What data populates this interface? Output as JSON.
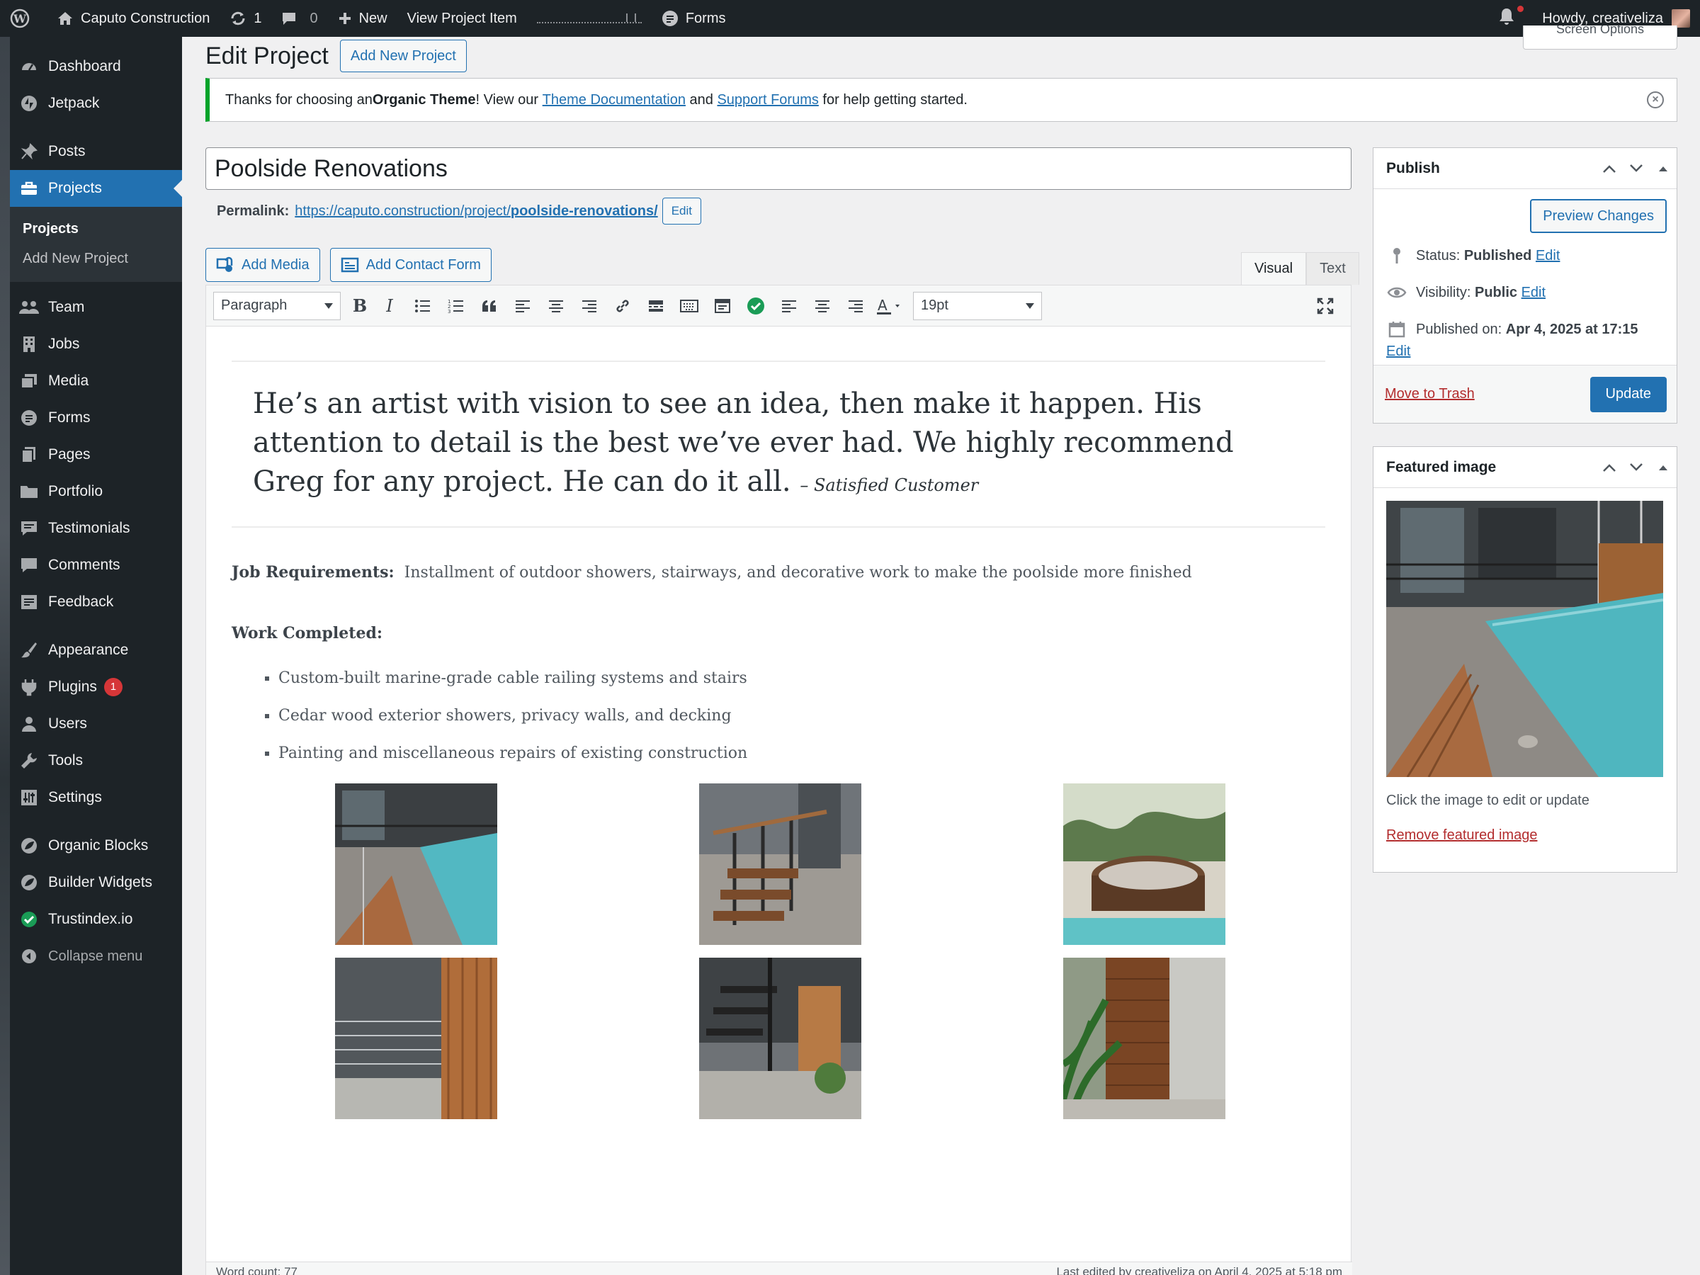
{
  "adminbar": {
    "site_name": "Caputo Construction",
    "updates_count": "1",
    "comments_count": "0",
    "new_label": "New",
    "view_item": "View Project Item",
    "forms_label": "Forms",
    "howdy": "Howdy, creativeliza"
  },
  "sidebar": {
    "items": [
      {
        "label": "Dashboard",
        "icon": "dashboard-icon"
      },
      {
        "label": "Jetpack",
        "icon": "jetpack-icon"
      },
      {
        "label": "Posts",
        "icon": "pin-icon"
      },
      {
        "label": "Projects",
        "icon": "briefcase-icon"
      },
      {
        "label": "Team",
        "icon": "team-icon"
      },
      {
        "label": "Jobs",
        "icon": "building-icon"
      },
      {
        "label": "Media",
        "icon": "media-icon"
      },
      {
        "label": "Forms",
        "icon": "forms-icon"
      },
      {
        "label": "Pages",
        "icon": "pages-icon"
      },
      {
        "label": "Portfolio",
        "icon": "folder-icon"
      },
      {
        "label": "Testimonials",
        "icon": "testimonial-icon"
      },
      {
        "label": "Comments",
        "icon": "comment-icon"
      },
      {
        "label": "Feedback",
        "icon": "feedback-icon"
      },
      {
        "label": "Appearance",
        "icon": "brush-icon"
      },
      {
        "label": "Plugins",
        "icon": "plugin-icon"
      },
      {
        "label": "Users",
        "icon": "user-icon"
      },
      {
        "label": "Tools",
        "icon": "wrench-icon"
      },
      {
        "label": "Settings",
        "icon": "settings-icon"
      },
      {
        "label": "Organic Blocks",
        "icon": "organic-icon"
      },
      {
        "label": "Builder Widgets",
        "icon": "organic-icon"
      },
      {
        "label": "Trustindex.io",
        "icon": "check-icon"
      }
    ],
    "submenu": [
      "Projects",
      "Add New Project"
    ],
    "plugins_badge": "1",
    "collapse": "Collapse menu"
  },
  "page": {
    "title": "Edit Project",
    "add_new": "Add New Project"
  },
  "notice": {
    "prefix": "Thanks for choosing an ",
    "theme": "Organic Theme",
    "mid1": "! View our ",
    "doc_link": "Theme Documentation",
    "mid2": " and ",
    "forum_link": "Support Forums",
    "suffix": " for help getting started."
  },
  "post": {
    "title": "Poolside Renovations",
    "permalink_label": "Permalink:",
    "permalink_base": "https://caputo.construction/project/",
    "permalink_slug": "poolside-renovations/",
    "edit_label": "Edit"
  },
  "media_buttons": {
    "add_media": "Add Media",
    "add_contact_form": "Add Contact Form"
  },
  "editor_tabs": {
    "visual": "Visual",
    "text": "Text"
  },
  "toolbar": {
    "format": "Paragraph",
    "font_size": "19pt"
  },
  "content": {
    "quote": "He’s an artist with vision to see an idea, then make it happen. His attention to detail is the best we’ve ever had. We highly recommend Greg for any project. He can do it all.",
    "cite": "– Satisfied Customer",
    "job_label": "Job Requirements:",
    "job_text": "Installment of outdoor showers, stairways, and decorative work to make the poolside more finished",
    "work_label": "Work Completed:",
    "work_items": [
      "Custom-built marine-grade cable railing systems and stairs",
      "Cedar wood exterior showers, privacy walls, and decking",
      "Painting and miscellaneous repairs of existing construction"
    ]
  },
  "editor_footer": {
    "word_count": "Word count: 77",
    "last_edited": "Last edited by creativeliza on April 4, 2025 at 5:18 pm"
  },
  "publish": {
    "title": "Publish",
    "preview": "Preview Changes",
    "status_label": "Status:",
    "status_value": "Published",
    "visibility_label": "Visibility:",
    "visibility_value": "Public",
    "published_label": "Published on:",
    "published_value": "Apr 4, 2025 at 17:15",
    "edit": "Edit",
    "trash": "Move to Trash",
    "update": "Update"
  },
  "featured": {
    "title": "Featured image",
    "help": "Click the image to edit or update",
    "remove": "Remove featured image"
  },
  "screen_options": "Screen Options",
  "colors": {
    "accent": "#2271b1",
    "sidebar": "#1d2327",
    "current": "#2271b1",
    "success": "#00a32a",
    "danger": "#d63638",
    "pool": "#4fb6bf"
  }
}
